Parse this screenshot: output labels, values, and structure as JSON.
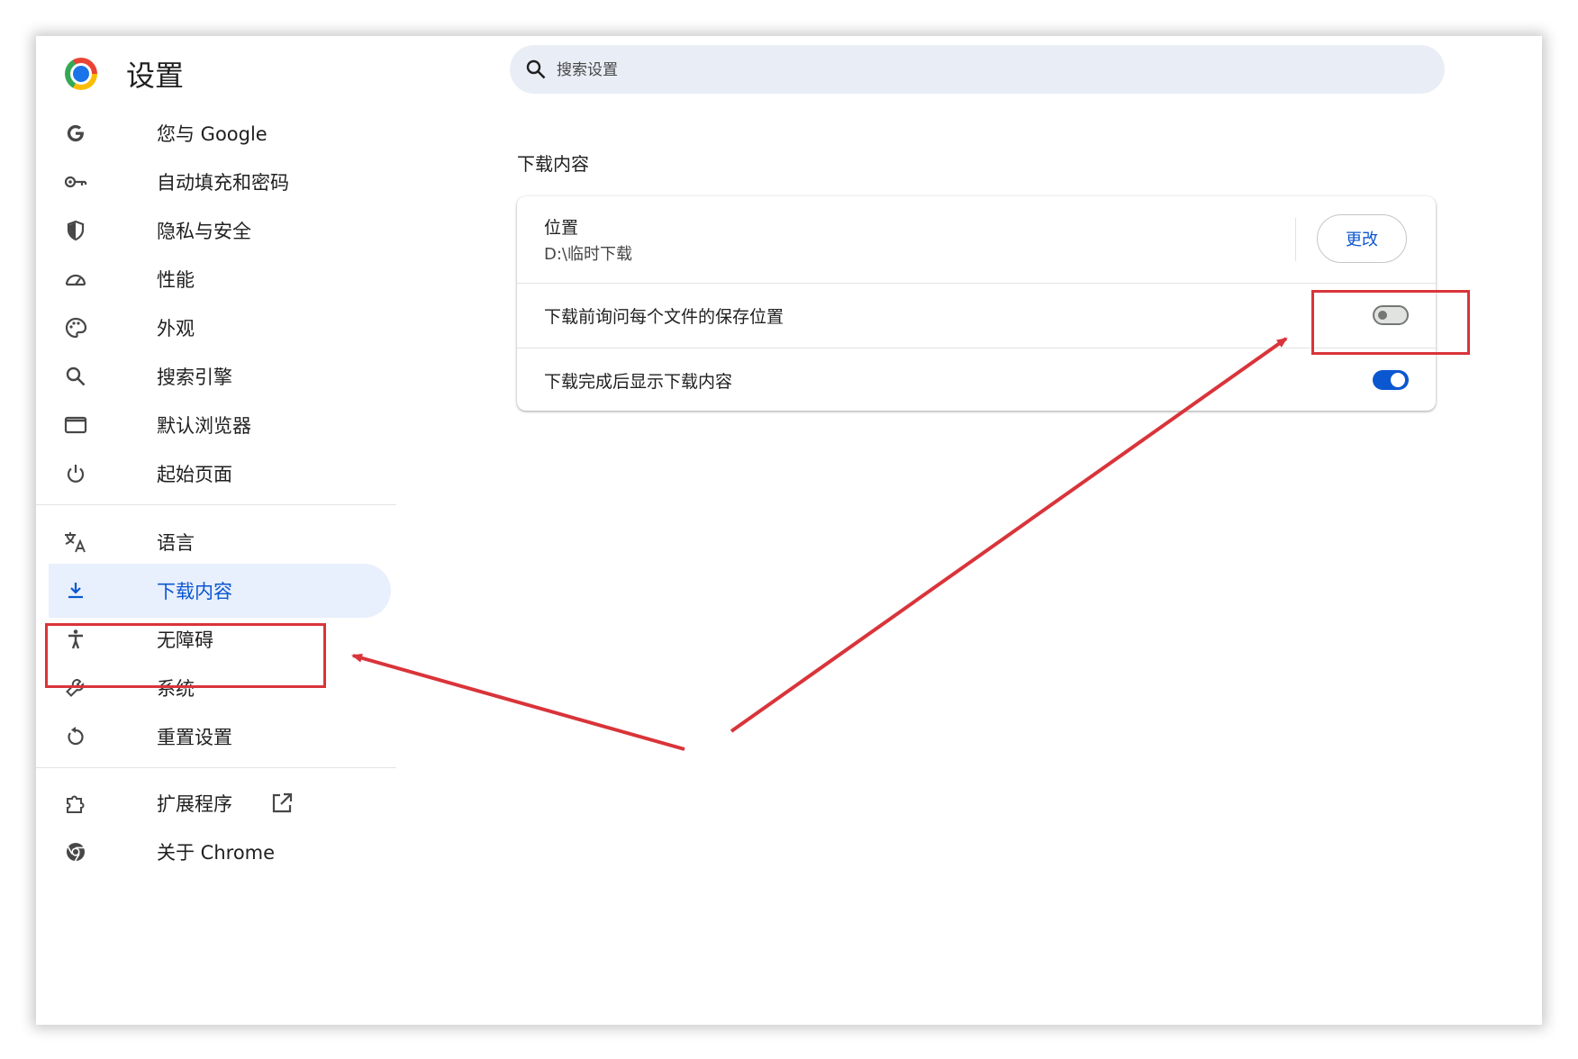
{
  "app": {
    "title": "设置"
  },
  "search": {
    "placeholder": "搜索设置"
  },
  "sidebar": {
    "items": [
      {
        "label": "您与 Google",
        "icon": "google-g-icon"
      },
      {
        "label": "自动填充和密码",
        "icon": "key-icon"
      },
      {
        "label": "隐私与安全",
        "icon": "shield-icon"
      },
      {
        "label": "性能",
        "icon": "speedometer-icon"
      },
      {
        "label": "外观",
        "icon": "palette-icon"
      },
      {
        "label": "搜索引擎",
        "icon": "search-icon"
      },
      {
        "label": "默认浏览器",
        "icon": "browser-window-icon"
      },
      {
        "label": "起始页面",
        "icon": "power-icon"
      },
      {
        "label": "语言",
        "icon": "translate-icon"
      },
      {
        "label": "下载内容",
        "icon": "download-icon",
        "active": true
      },
      {
        "label": "无障碍",
        "icon": "accessibility-icon"
      },
      {
        "label": "系统",
        "icon": "wrench-icon"
      },
      {
        "label": "重置设置",
        "icon": "reset-icon"
      },
      {
        "label": "扩展程序",
        "icon": "puzzle-icon",
        "external": true
      },
      {
        "label": "关于 Chrome",
        "icon": "chrome-icon"
      }
    ]
  },
  "downloads": {
    "section_title": "下载内容",
    "location_label": "位置",
    "location_value": "D:\\临时下载",
    "change_button": "更改",
    "ask_where_label": "下载前询问每个文件的保存位置",
    "ask_where_enabled": false,
    "show_after_label": "下载完成后显示下载内容",
    "show_after_enabled": true
  },
  "colors": {
    "accent": "#0b57d0",
    "active_bg": "#e8effd",
    "annotation": "#d9343a",
    "search_bg": "#e9eef6"
  }
}
